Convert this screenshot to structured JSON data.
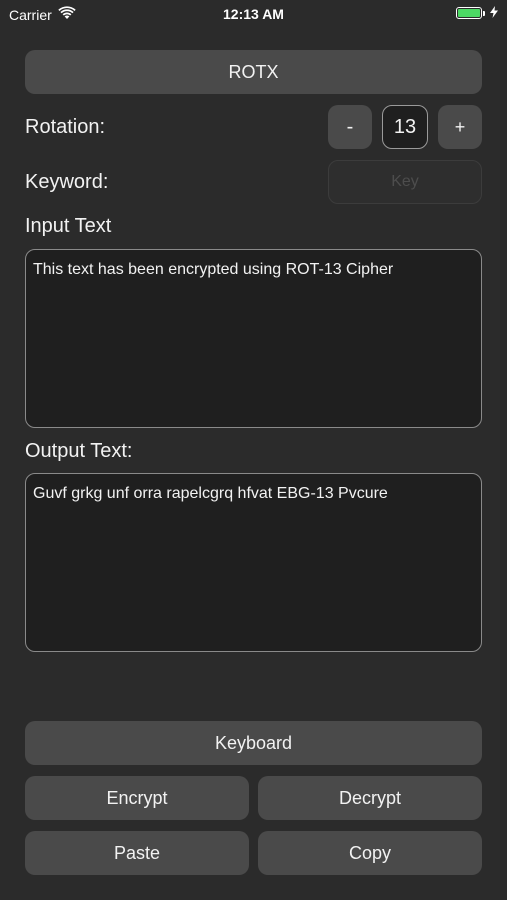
{
  "status_bar": {
    "carrier": "Carrier",
    "time": "12:13 AM",
    "wifi_icon": "wifi-icon",
    "battery_icon": "battery-icon",
    "charging_icon": "bolt-icon",
    "battery_level": 1.0
  },
  "title_button": "ROTX",
  "rotation": {
    "label": "Rotation:",
    "minus_label": "-",
    "value": "13",
    "plus_label": "+"
  },
  "keyword": {
    "label": "Keyword:",
    "placeholder": "Key"
  },
  "input": {
    "label": "Input Text",
    "text": "This text has been encrypted using ROT-13 Cipher"
  },
  "output": {
    "label": "Output Text:",
    "text": "Guvf grkg unf orra rapelcgrq hfvat EBG-13 Pvcure"
  },
  "actions": {
    "keyboard": "Keyboard",
    "encrypt": "Encrypt",
    "decrypt": "Decrypt",
    "paste": "Paste",
    "copy": "Copy"
  },
  "colors": {
    "background": "#2b2b2b",
    "button": "#4a4a4a",
    "field": "#1f1f1f",
    "battery": "#4cd964"
  }
}
